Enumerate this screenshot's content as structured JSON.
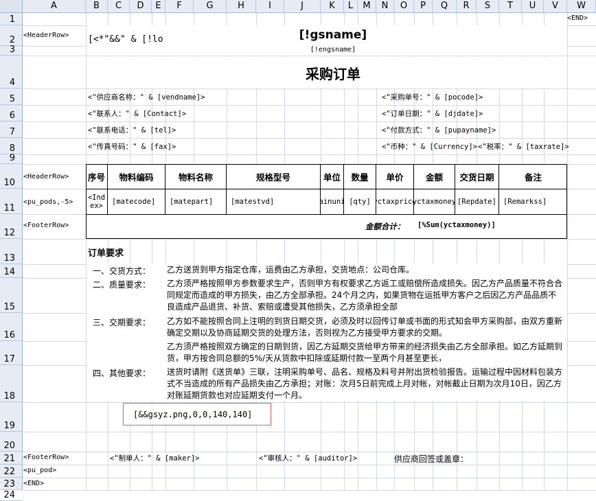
{
  "columns": [
    "A",
    "B",
    "C",
    "D",
    "E",
    "F",
    "G",
    "H",
    "I",
    "J",
    "K",
    "L",
    "M",
    "N",
    "O",
    "P",
    "Q",
    "R",
    "S",
    "T",
    "U",
    "V",
    "W"
  ],
  "rows": [
    "1",
    "2",
    "3",
    "4",
    "5",
    "6",
    "7",
    "8",
    "9",
    "10",
    "11",
    "12",
    "13",
    "14",
    "15",
    "16",
    "17",
    "18",
    "19",
    "20",
    "21",
    "22",
    "23",
    "24"
  ],
  "tags": {
    "end_top": "<END>",
    "header_row_1": "<HeaderRow>",
    "header_row_2": "<HeaderRow>",
    "pu_pods": "<pu_pods,-5>",
    "footer_row_1": "<FooterRow>",
    "footer_row_2": "<FooterRow>",
    "pu_pod": "<pu_pod>",
    "end_bottom": "<END>"
  },
  "header": {
    "logo_expr": "[<*\"&&\" & [!lo",
    "gsname": "[!gsname]",
    "engsname": "[!engsname]",
    "doc_title": "采购订单"
  },
  "info": {
    "vendname": "<\"供应商名称：\" & [vendname]>",
    "contact": "<\"联系人：\" & [Contact]>",
    "tel": "<\"联系电话：\" & [tel]>",
    "fax": "<\"传真号码：\" & [fax]>",
    "pocode": "<\"采购单号：\" & [pocode]>",
    "djdate": "<\"订单日期：\" & [djdate]>",
    "pupayname": "<\"付款方式：\" & [pupayname]>",
    "currency": "<\"币种：\" & [Currency]>",
    "taxrate": "<\"税率：\" & [taxrate]>"
  },
  "table": {
    "headers": [
      "序号",
      "物料编码",
      "物料名称",
      "规格型号",
      "单位",
      "数量",
      "单价",
      "金额",
      "交货日期",
      "备注"
    ],
    "row": [
      "<Index>",
      "[matecode]",
      "[matepart]",
      "[matestvd]",
      "[mainunit]",
      "[qty]",
      "[yctaxprice]",
      "[yctaxmoney]",
      "[Repdate]",
      "[Remarkss]"
    ],
    "row_index_line1": "<Ind",
    "row_index_line2": "ex>",
    "sum_label": "金额合计：",
    "sum_value": "[%Sum(yctaxmoney)]"
  },
  "requirements": {
    "title": "订单要求",
    "items": [
      {
        "label": "一、交货方式：",
        "text": "乙方送货到甲方指定仓库，运费由乙方承担，交货地点：公司仓库。"
      },
      {
        "label": "二、质量要求：",
        "text": "乙方须严格按照甲方参数要求生产，否则甲方有权要求乙方返工或赔偿所造成损失。因乙方产品质量不符合合同规定而造成的甲方损失，由乙方全部承担。24个月之内，如果货物在运抵甲方客户之后因乙方产品品质不良造成产品退货、补货、索赔或遭受其他损失，乙方须承担全部"
      },
      {
        "label": "三、交期要求：",
        "text": "乙方如不能按照合同上注明的到货日期交货，必须及时以回传订单或书面的形式知会甲方采购部，由双方重新确定交期以及协商延期交货的处理方法，否则视为乙方接受甲方要求的交期。"
      },
      {
        "label": "",
        "text": "乙方须严格按照双方确定的日期到货，因乙方延期交货给甲方带来的经济损失由乙方全部承担。如乙方延期到货，甲方按合同总额的5%/天从货款中扣除或延期付款一至两个月甚至更长，"
      },
      {
        "label": "四、其他要求：",
        "text": "送货时请附《送货单》三联，注明采购单号、品名、规格及料号并附出货检验报告。运输过程中因材料包装方式不当造成的所有产品损失由乙方承担；对账：次月5日前完成上月对帐，对帐截止日期为次月10日，因乙方对账延期货款也对应延期支付一个月。"
      }
    ]
  },
  "stamp": "[&&gsyz.png,0,0,140,140]",
  "footer": {
    "maker": "<\"制单人：\" & [maker]>",
    "auditor": "<\"审核人：\" & [auditor]>",
    "vendor_sign": "供应商回签或盖章："
  },
  "colors": {
    "header_bg": "#e6ebf4",
    "grid": "#d0d7e5",
    "stamp_border": "#e06060"
  }
}
